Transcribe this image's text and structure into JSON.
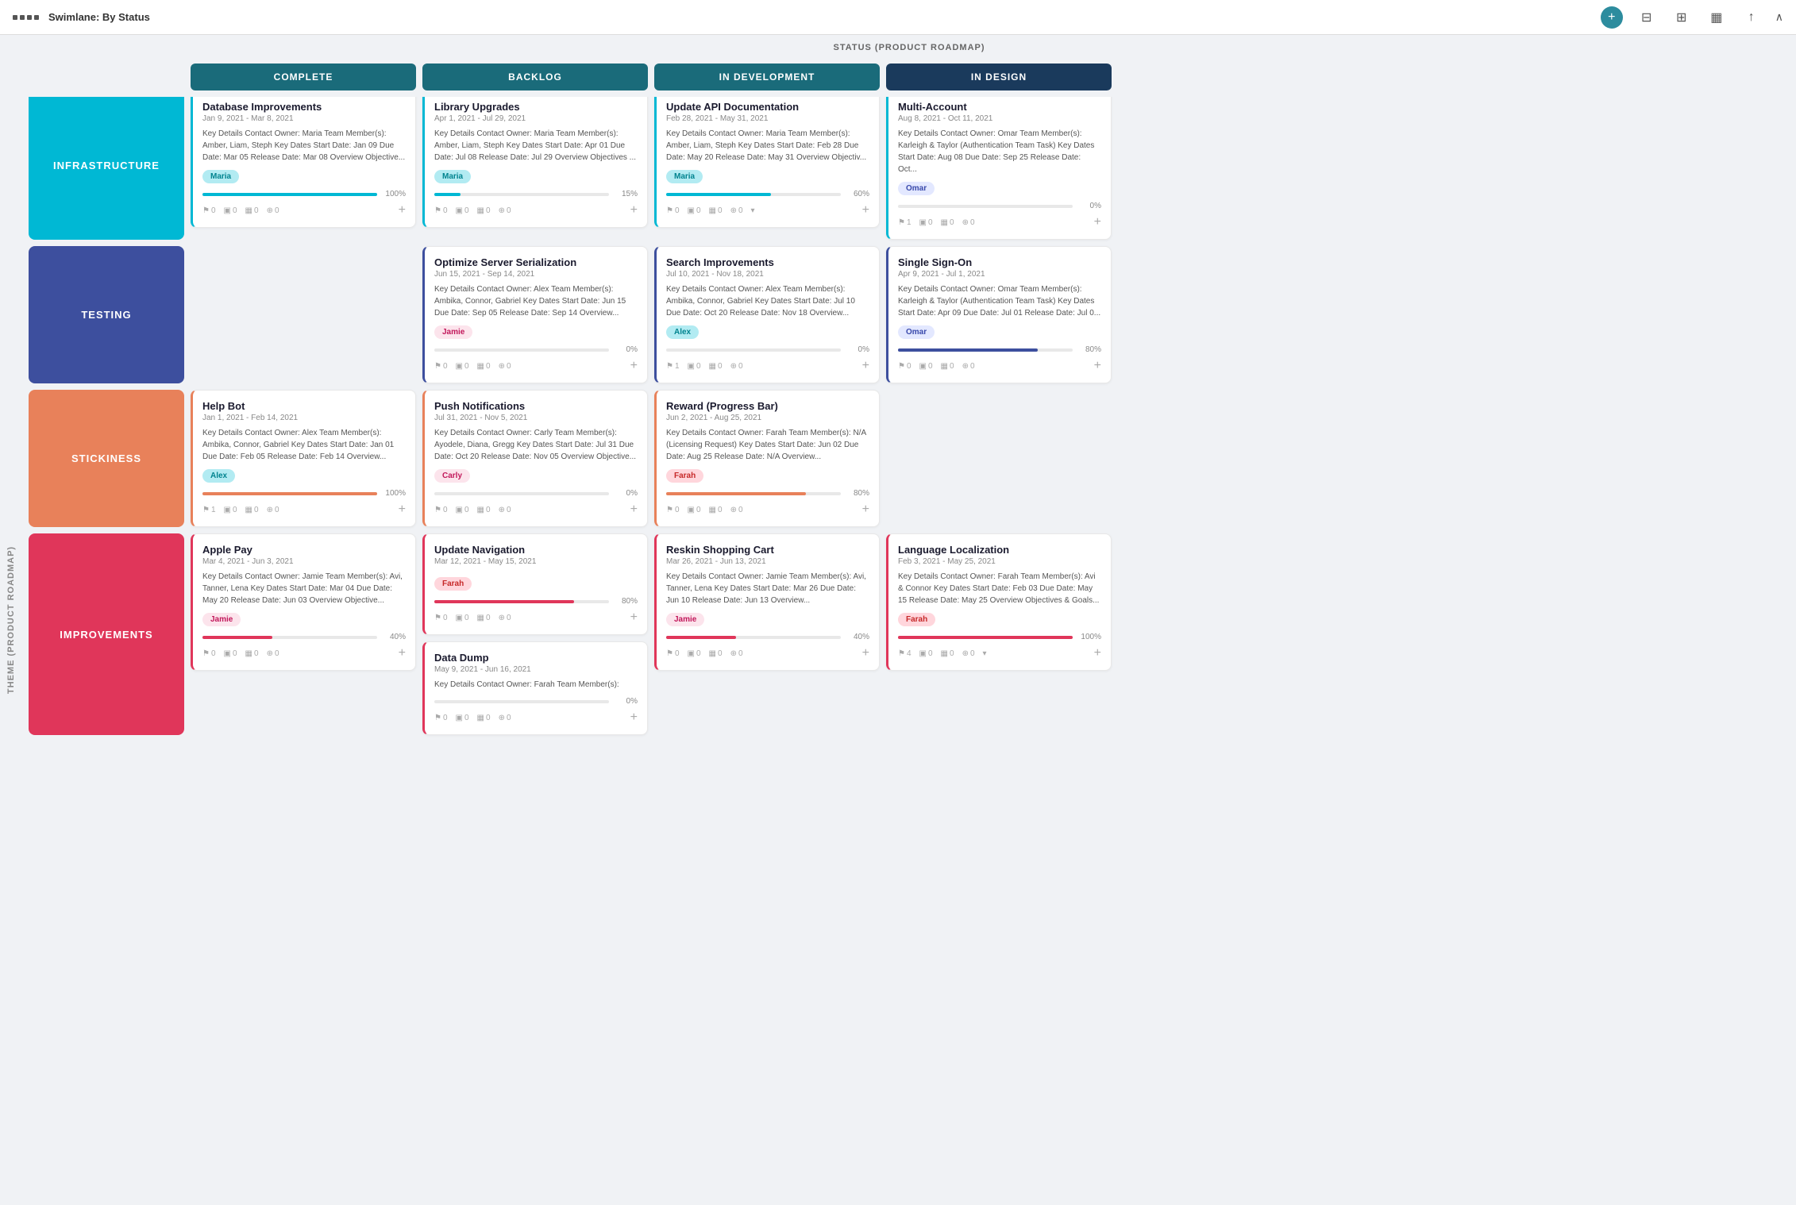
{
  "header": {
    "title": "Swimlane: By Status",
    "plus_label": "+",
    "theme_label": "THEME (PRODUCT ROADMAP)"
  },
  "status_bar": {
    "label": "STATUS (PRODUCT ROADMAP)"
  },
  "columns": [
    {
      "id": "complete",
      "label": "COMPLETE",
      "style": "complete"
    },
    {
      "id": "backlog",
      "label": "BACKLOG",
      "style": "backlog"
    },
    {
      "id": "indev",
      "label": "IN DEVELOPMENT",
      "style": "indev"
    },
    {
      "id": "indesign",
      "label": "IN DESIGN",
      "style": "indesign"
    }
  ],
  "rows": [
    {
      "id": "infrastructure",
      "label": "INFRASTRUCTURE",
      "style": "infra",
      "cards": {
        "complete": [
          {
            "title": "Database Improvements",
            "date": "Jan 9, 2021 - Mar 8, 2021",
            "body": "Key Details Contact Owner: Maria Team Member(s): Amber, Liam, Steph Key Dates Start Date: Jan 09 Due Date: Mar 05 Release Date: Mar 08 Overview Objective...",
            "avatar": "Maria",
            "avatar_style": "cyan",
            "progress": 100,
            "bar_style": "cyan",
            "footer": {
              "f1": "0",
              "f2": "0",
              "f3": "0",
              "f4": "0"
            }
          }
        ],
        "backlog": [
          {
            "title": "Library Upgrades",
            "date": "Apr 1, 2021 - Jul 29, 2021",
            "body": "Key Details Contact Owner: Maria Team Member(s): Amber, Liam, Steph Key Dates Start Date: Apr 01 Due Date: Jul 08 Release Date: Jul 29 Overview Objectives ...",
            "avatar": "Maria",
            "avatar_style": "cyan",
            "progress": 15,
            "bar_style": "cyan",
            "footer": {
              "f1": "0",
              "f2": "0",
              "f3": "0",
              "f4": "0"
            }
          }
        ],
        "indev": [
          {
            "title": "Update API Documentation",
            "date": "Feb 28, 2021 - May 31, 2021",
            "body": "Key Details Contact Owner: Maria Team Member(s): Amber, Liam, Steph Key Dates Start Date: Feb 28 Due Date: May 20 Release Date: May 31 Overview Objectiv...",
            "avatar": "Maria",
            "avatar_style": "cyan",
            "progress": 60,
            "bar_style": "cyan",
            "footer": {
              "f1": "0",
              "f2": "0",
              "f3": "0",
              "f4": "0"
            },
            "expand": true
          }
        ],
        "indesign": [
          {
            "title": "Multi-Account",
            "date": "Aug 8, 2021 - Oct 11, 2021",
            "body": "Key Details Contact Owner: Omar Team Member(s): Karleigh & Taylor (Authentication Team Task) Key Dates Start Date: Aug 08 Due Date: Sep 25 Release Date: Oct...",
            "avatar": "Omar",
            "avatar_style": "blue",
            "progress": 0,
            "bar_style": "cyan",
            "footer": {
              "f1": "1",
              "f2": "0",
              "f3": "0",
              "f4": "0"
            }
          }
        ]
      }
    },
    {
      "id": "testing",
      "label": "TESTING",
      "style": "testing",
      "cards": {
        "complete": [],
        "backlog": [
          {
            "title": "Optimize Server Serialization",
            "date": "Jun 15, 2021 - Sep 14, 2021",
            "body": "Key Details Contact Owner: Alex Team Member(s): Ambika, Connor, Gabriel Key Dates Start Date: Jun 15 Due Date: Sep 05 Release Date: Sep 14 Overview...",
            "avatar": "Jamie",
            "avatar_style": "pink",
            "progress": 0,
            "bar_style": "blue",
            "footer": {
              "f1": "0",
              "f2": "0",
              "f3": "0",
              "f4": "0"
            }
          }
        ],
        "indev": [
          {
            "title": "Search Improvements",
            "date": "Jul 10, 2021 - Nov 18, 2021",
            "body": "Key Details Contact Owner: Alex Team Member(s): Ambika, Connor, Gabriel Key Dates Start Date: Jul 10 Due Date: Oct 20 Release Date: Nov 18 Overview...",
            "avatar": "Alex",
            "avatar_style": "cyan",
            "progress": 0,
            "bar_style": "blue",
            "footer": {
              "f1": "1",
              "f2": "0",
              "f3": "0",
              "f4": "0"
            }
          }
        ],
        "indesign": [
          {
            "title": "Single Sign-On",
            "date": "Apr 9, 2021 - Jul 1, 2021",
            "body": "Key Details Contact Owner: Omar Team Member(s): Karleigh & Taylor (Authentication Team Task) Key Dates Start Date: Apr 09 Due Date: Jul 01 Release Date: Jul 0...",
            "avatar": "Omar",
            "avatar_style": "blue",
            "progress": 80,
            "bar_style": "blue",
            "footer": {
              "f1": "0",
              "f2": "0",
              "f3": "0",
              "f4": "0"
            }
          }
        ]
      }
    },
    {
      "id": "stickiness",
      "label": "STICKINESS",
      "style": "stickiness",
      "cards": {
        "complete": [
          {
            "title": "Help Bot",
            "date": "Jan 1, 2021 - Feb 14, 2021",
            "body": "Key Details Contact Owner: Alex Team Member(s): Ambika, Connor, Gabriel Key Dates Start Date: Jan 01 Due Date: Feb 05 Release Date: Feb 14 Overview...",
            "avatar": "Alex",
            "avatar_style": "cyan",
            "progress": 100,
            "bar_style": "orange",
            "footer": {
              "f1": "1",
              "f2": "0",
              "f3": "0",
              "f4": "0"
            }
          }
        ],
        "backlog": [
          {
            "title": "Push Notifications",
            "date": "Jul 31, 2021 - Nov 5, 2021",
            "body": "Key Details Contact Owner: Carly Team Member(s): Ayodele, Diana, Gregg Key Dates Start Date: Jul 31 Due Date: Oct 20 Release Date: Nov 05 Overview Objective...",
            "avatar": "Carly",
            "avatar_style": "pink",
            "progress": 0,
            "bar_style": "orange",
            "footer": {
              "f1": "0",
              "f2": "0",
              "f3": "0",
              "f4": "0"
            }
          }
        ],
        "indev": [
          {
            "title": "Reward (Progress Bar)",
            "date": "Jun 2, 2021 - Aug 25, 2021",
            "body": "Key Details Contact Owner: Farah Team Member(s): N/A (Licensing Request) Key Dates Start Date: Jun 02 Due Date: Aug 25 Release Date: N/A Overview...",
            "avatar": "Farah",
            "avatar_style": "red",
            "progress": 80,
            "bar_style": "orange",
            "footer": {
              "f1": "0",
              "f2": "0",
              "f3": "0",
              "f4": "0"
            }
          }
        ],
        "indesign": []
      }
    },
    {
      "id": "improvements",
      "label": "IMPROVEMENTS",
      "style": "improvements",
      "cards": {
        "complete": [
          {
            "title": "Apple Pay",
            "date": "Mar 4, 2021 - Jun 3, 2021",
            "body": "Key Details Contact Owner: Jamie Team Member(s): Avi, Tanner, Lena Key Dates Start Date: Mar 04 Due Date: May 20 Release Date: Jun 03 Overview Objective...",
            "avatar": "Jamie",
            "avatar_style": "pink",
            "progress": 40,
            "bar_style": "red",
            "footer": {
              "f1": "0",
              "f2": "0",
              "f3": "0",
              "f4": "0"
            }
          }
        ],
        "backlog": [
          {
            "title": "Update Navigation",
            "date": "Mar 12, 2021 - May 15, 2021",
            "body": "",
            "avatar": "Farah",
            "avatar_style": "red",
            "progress": 80,
            "bar_style": "red",
            "footer": {
              "f1": "0",
              "f2": "0",
              "f3": "0",
              "f4": "0"
            }
          },
          {
            "title": "Data Dump",
            "date": "May 9, 2021 - Jun 16, 2021",
            "body": "Key Details Contact Owner: Farah Team Member(s):",
            "avatar": null,
            "progress": 0,
            "bar_style": "red",
            "footer": {
              "f1": "0",
              "f2": "0",
              "f3": "0",
              "f4": "0"
            }
          }
        ],
        "indev": [
          {
            "title": "Reskin Shopping Cart",
            "date": "Mar 26, 2021 - Jun 13, 2021",
            "body": "Key Details Contact Owner: Jamie Team Member(s): Avi, Tanner, Lena Key Dates Start Date: Mar 26 Due Date: Jun 10 Release Date: Jun 13 Overview...",
            "avatar": "Jamie",
            "avatar_style": "pink",
            "progress": 40,
            "bar_style": "red",
            "footer": {
              "f1": "0",
              "f2": "0",
              "f3": "0",
              "f4": "0"
            }
          }
        ],
        "indesign": [
          {
            "title": "Language Localization",
            "date": "Feb 3, 2021 - May 25, 2021",
            "body": "Key Details Contact Owner: Farah Team Member(s): Avi & Connor Key Dates Start Date: Feb 03 Due Date: May 15 Release Date: May 25 Overview Objectives & Goals...",
            "avatar": "Farah",
            "avatar_style": "red",
            "progress": 100,
            "bar_style": "red",
            "footer": {
              "f1": "4",
              "f2": "0",
              "f3": "0",
              "f4": "0"
            },
            "expand": true
          }
        ]
      }
    }
  ]
}
